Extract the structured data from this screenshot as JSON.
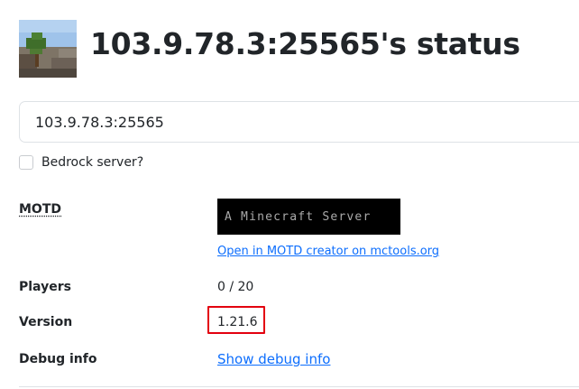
{
  "header": {
    "title": "103.9.78.3:25565's status",
    "icon": "server-icon-minecraft"
  },
  "address": {
    "value": "103.9.78.3:25565"
  },
  "bedrock": {
    "label": "Bedrock server?",
    "checked": false
  },
  "motd": {
    "label": "MOTD",
    "text": "A Minecraft Server",
    "creator_link": "Open in MOTD creator on mctools.org"
  },
  "players": {
    "label": "Players",
    "value": "0 / 20"
  },
  "version": {
    "label": "Version",
    "value": "1.21.6",
    "highlight_color": "#e3000f"
  },
  "debug": {
    "label": "Debug info",
    "link": "Show debug info"
  },
  "colors": {
    "link": "#0d6efd",
    "text": "#212529",
    "motd_bg": "#000000",
    "motd_text": "#aaaaaa"
  }
}
